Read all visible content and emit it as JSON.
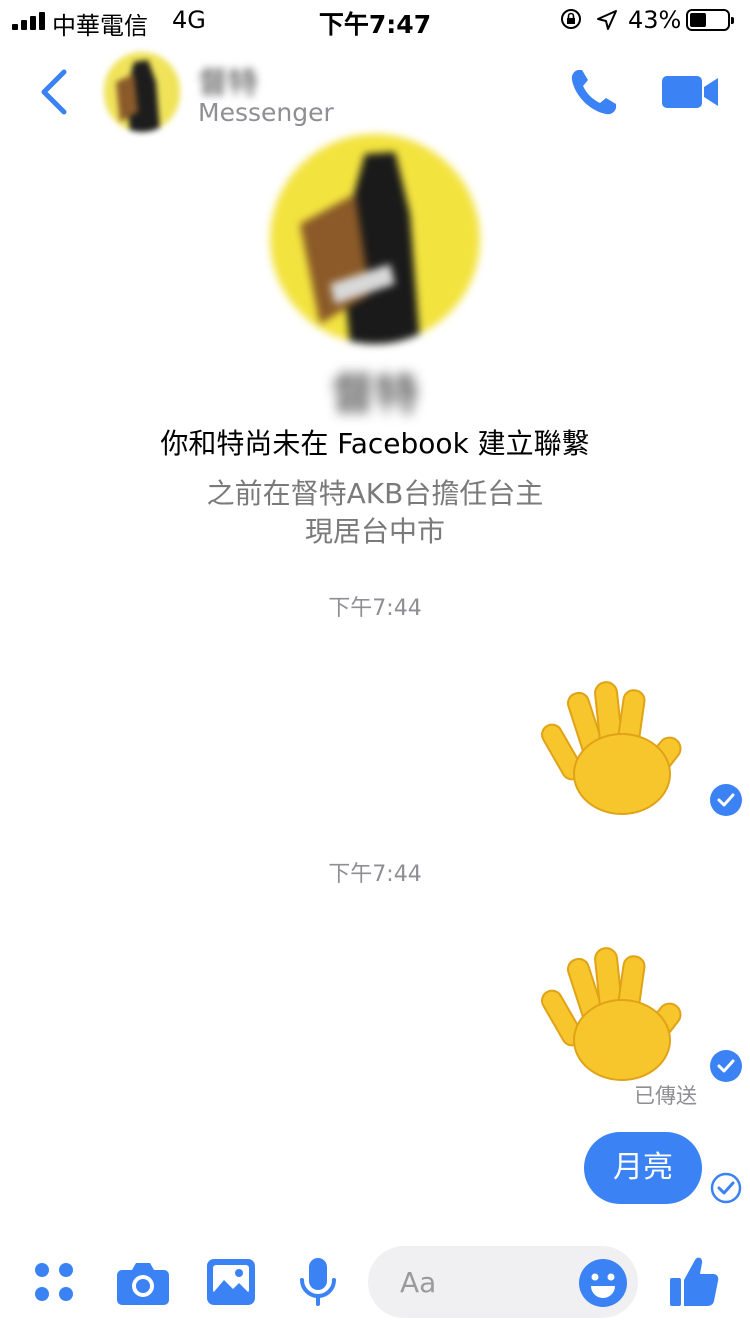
{
  "status_bar": {
    "carrier": "中華電信",
    "network": "4G",
    "time": "下午7:47",
    "battery_percent": "43%"
  },
  "header": {
    "contact_name": "督特",
    "subtitle": "Messenger"
  },
  "profile": {
    "name": "督特",
    "connection_note": "你和特尚未在 Facebook 建立聯繫",
    "work": "之前在督特AKB台擔任台主",
    "city": "現居台中市"
  },
  "messages": {
    "timestamp_1": "下午7:44",
    "timestamp_2": "下午7:44",
    "sent_label": "已傳送",
    "text_message": "月亮"
  },
  "composer": {
    "placeholder": "Aa"
  },
  "colors": {
    "accent": "#3b82f5",
    "wave_yellow": "#f7c52c"
  },
  "icons": [
    "back-icon",
    "phone-icon",
    "video-icon",
    "apps-icon",
    "camera-icon",
    "gallery-icon",
    "mic-icon",
    "emoji-icon",
    "like-icon",
    "check-icon"
  ]
}
